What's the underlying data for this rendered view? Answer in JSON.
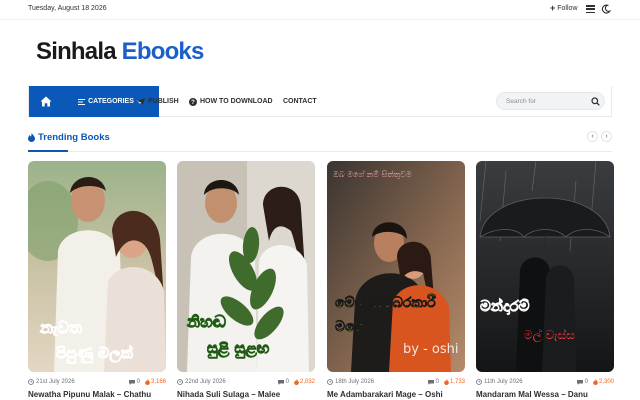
{
  "topbar": {
    "date": "Tuesday, August 18 2026",
    "follow_label": "Follow"
  },
  "logo": {
    "part1": "Sinhala",
    "part2": "Ebooks"
  },
  "nav": {
    "categories_label": "CATEGORIES",
    "publish_label": "PUBLISH",
    "how_to_label": "HOW TO DOWNLOAD",
    "contact_label": "CONTACT",
    "search_placeholder": "Search for"
  },
  "section": {
    "title": "Trending Books"
  },
  "colors": {
    "brand_blue": "#0a58b8",
    "views_orange": "#f26522"
  },
  "books": [
    {
      "date": "21st July 2026",
      "comments": "0",
      "views": "3,166",
      "title": "Newatha Pipunu Malak – Chathu",
      "cover_text_line1": "නැවත",
      "cover_text_line2": "පිපුණු මලක්"
    },
    {
      "date": "22nd July 2026",
      "comments": "0",
      "views": "2,032",
      "title": "Nihada Suli Sulaga – Malee",
      "cover_text_line1": "නිහඬ",
      "cover_text_line2": "සුළි සුළඟ"
    },
    {
      "date": "18th July 2026",
      "comments": "0",
      "views": "1,733",
      "title": "Me Adambarakari Mage – Oshi",
      "cover_text_top": "ඔබ මගේ නම් සිත්තුවම",
      "cover_text_line1": "මේ ආඩම්බරකාරී",
      "cover_text_line2": "මගේ",
      "cover_text_by": "by - oshi"
    },
    {
      "date": "11th July 2026",
      "comments": "0",
      "views": "2,300",
      "title": "Mandaram Mal Wessa – Danu",
      "cover_text_line1": "මන්දාරම්",
      "cover_text_line2": "මල් වැස්ස"
    }
  ]
}
